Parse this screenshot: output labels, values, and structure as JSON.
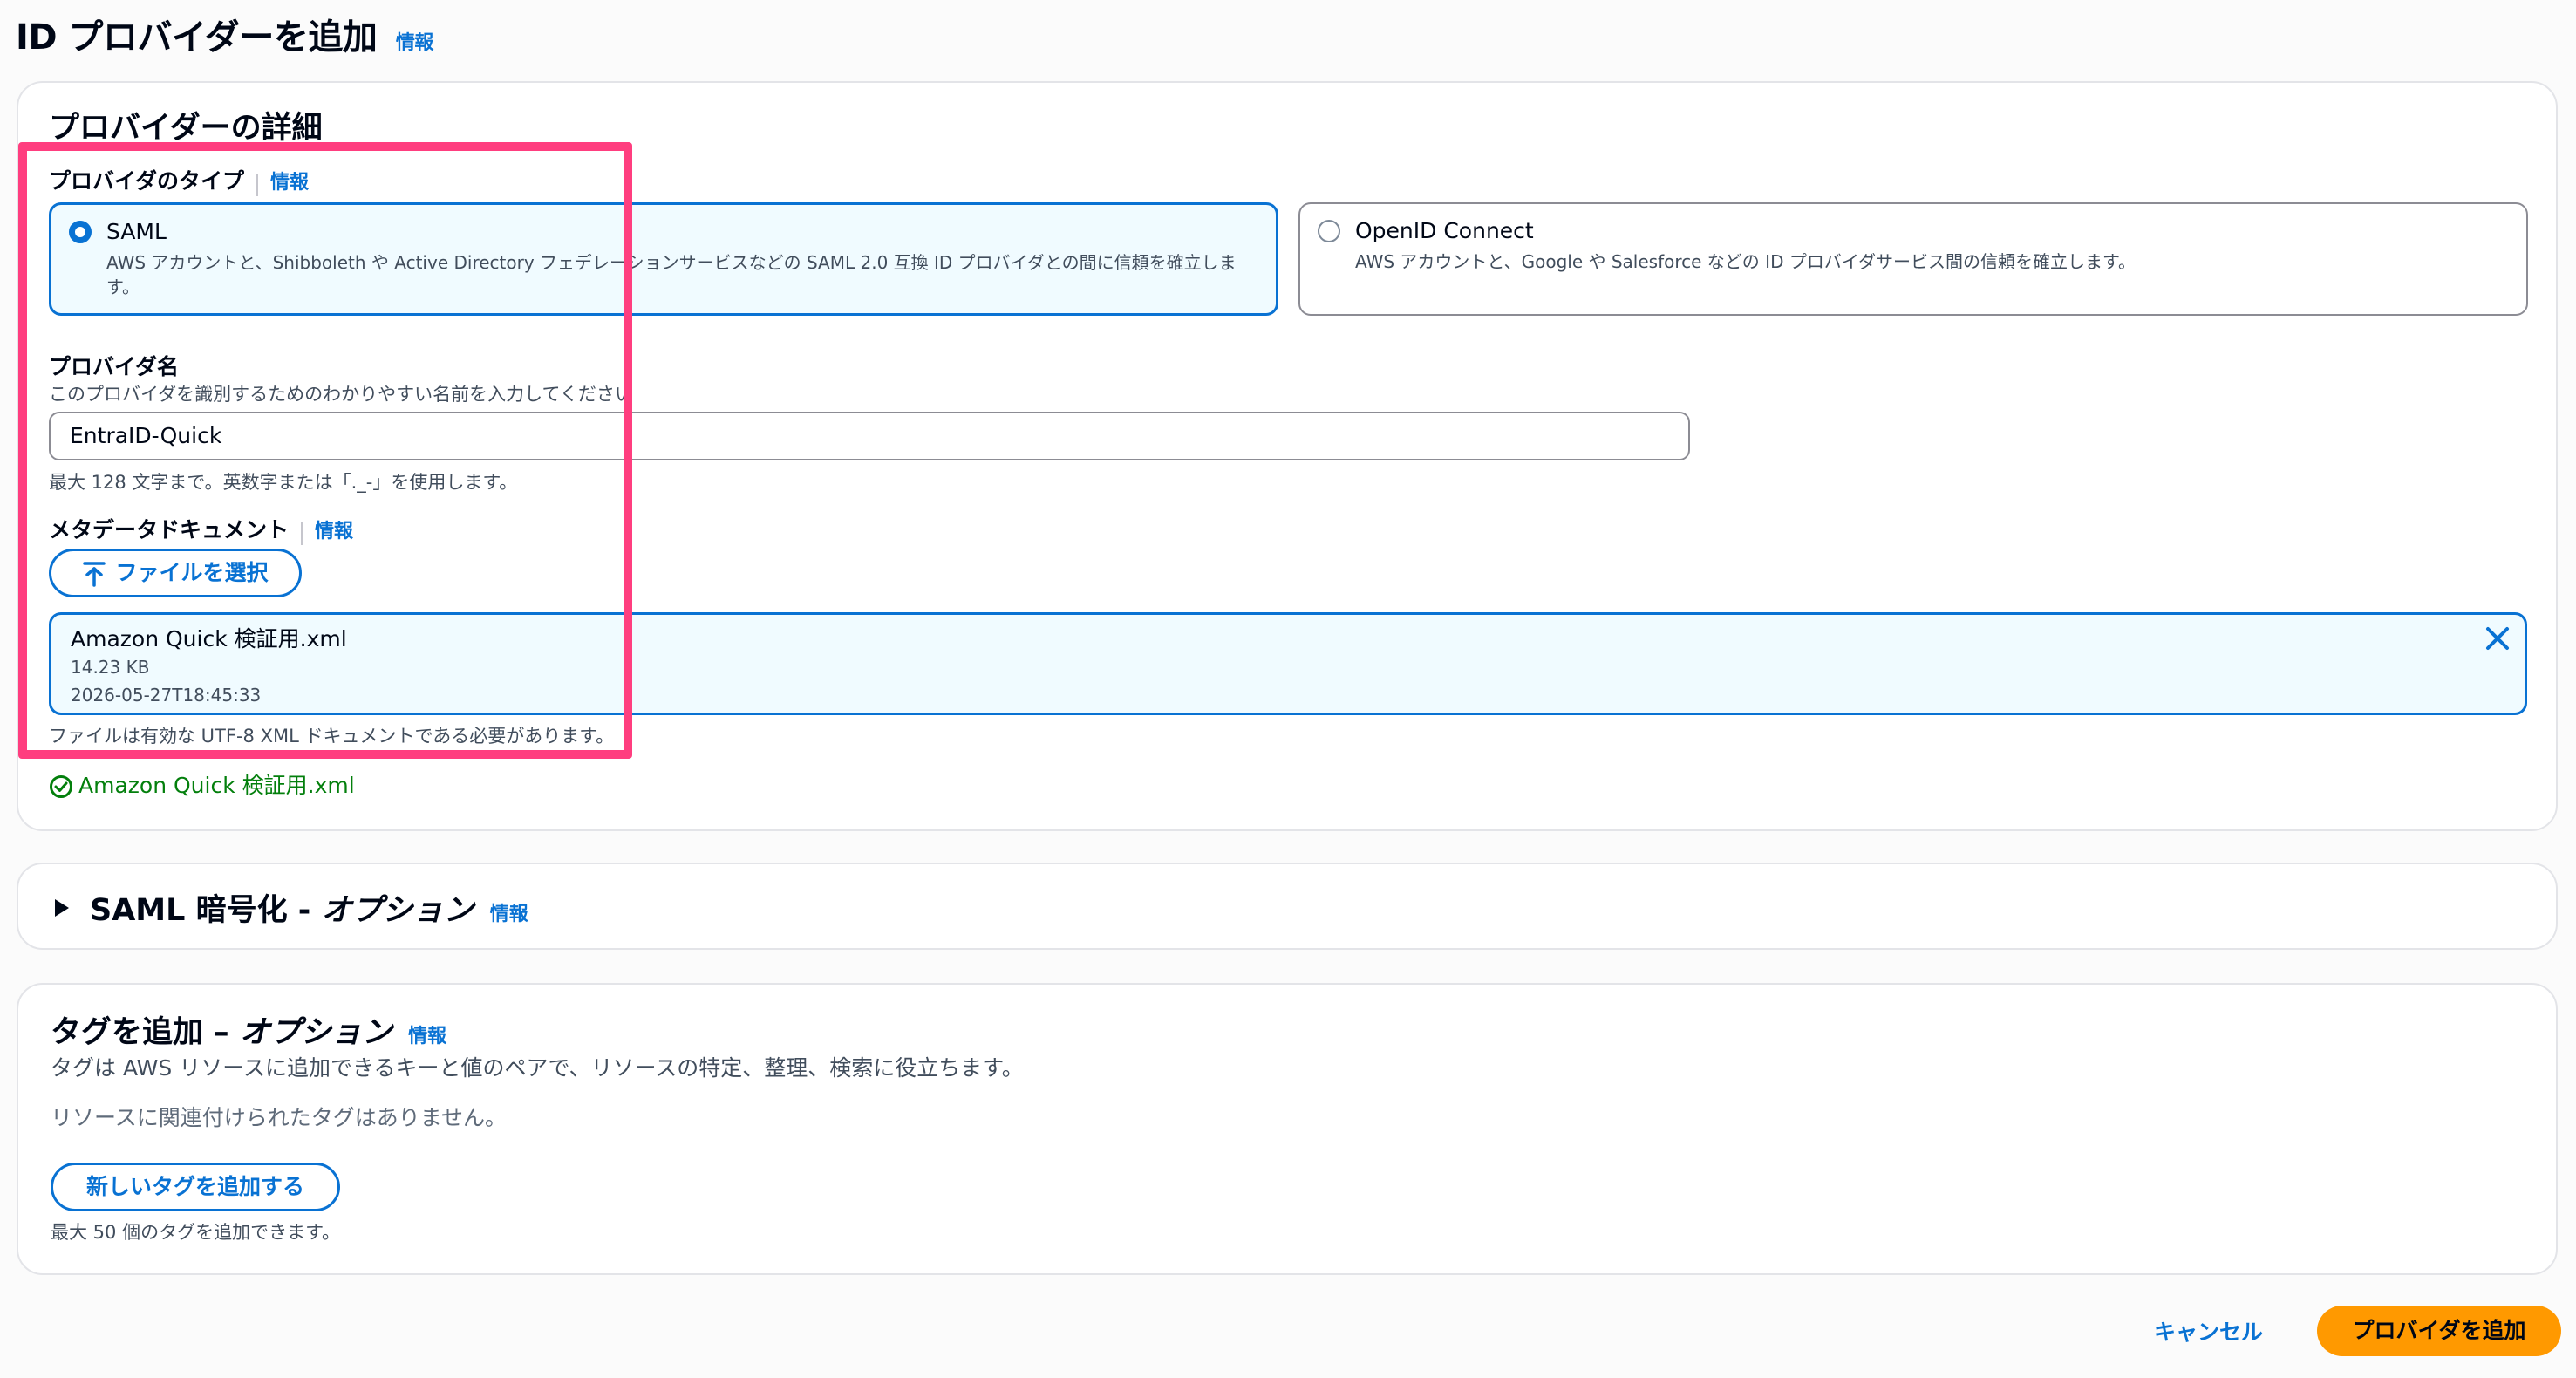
{
  "page": {
    "title": "ID プロバイダーを追加",
    "info": "情報"
  },
  "details": {
    "title": "プロバイダーの詳細",
    "provider_type": {
      "label": "プロバイダのタイプ",
      "info": "情報",
      "options": [
        {
          "title": "SAML",
          "desc": "AWS アカウントと、Shibboleth や Active Directory フェデレーションサービスなどの SAML 2.0 互換 ID プロバイダとの間に信頼を確立します。",
          "selected": true
        },
        {
          "title": "OpenID Connect",
          "desc": "AWS アカウントと、Google や Salesforce などの ID プロバイダサービス間の信頼を確立します。",
          "selected": false
        }
      ]
    },
    "provider_name": {
      "label": "プロバイダ名",
      "desc": "このプロバイダを識別するためのわかりやすい名前を入力してください",
      "value": "EntraID-Quick",
      "constraint": "最大 128 文字まで。英数字または「._-」を使用します。"
    },
    "metadata": {
      "label": "メタデータドキュメント",
      "info": "情報",
      "choose_file": "ファイルを選択",
      "file": {
        "name": "Amazon Quick 検証用.xml",
        "size": "14.23 KB",
        "modified": "2026-05-27T18:45:33"
      },
      "constraint": "ファイルは有効な UTF-8 XML ドキュメントである必要があります。",
      "success": "Amazon Quick 検証用.xml"
    }
  },
  "saml_encryption": {
    "title_main": "SAML 暗号化 - ",
    "title_opt": "オプション",
    "info": "情報"
  },
  "tags": {
    "title_main": "タグを追加 – ",
    "title_opt": "オプション",
    "info": "情報",
    "desc": "タグは AWS リソースに追加できるキーと値のペアで、リソースの特定、整理、検索に役立ちます。",
    "empty": "リソースに関連付けられたタグはありません。",
    "add_button": "新しいタグを追加する",
    "limit": "最大 50 個のタグを追加できます。"
  },
  "footer": {
    "cancel": "キャンセル",
    "submit": "プロバイダを追加"
  },
  "colors": {
    "accent": "#0972d3",
    "primary": "#ff9900",
    "success": "#037f0c",
    "highlight": "#ff3e7f"
  }
}
